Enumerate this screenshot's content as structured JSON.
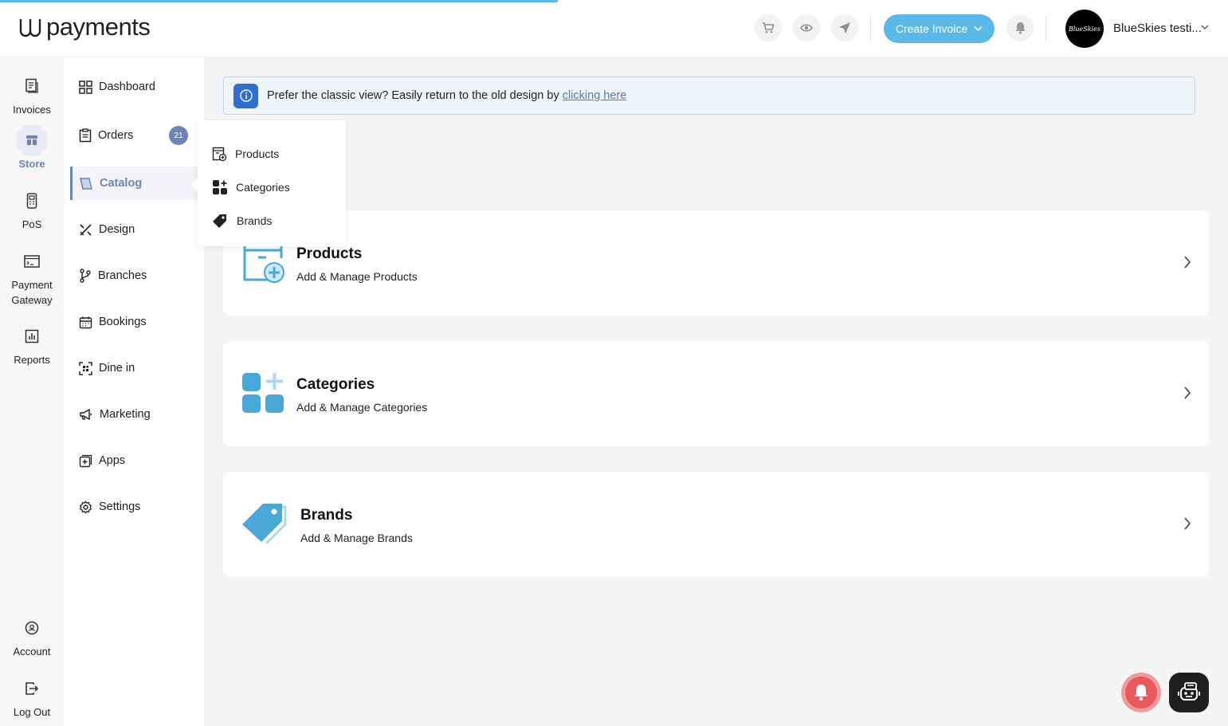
{
  "brand": {
    "logo_text": "payments"
  },
  "header": {
    "create_invoice_label": "Create Invoice",
    "user_name": "BlueSkies testi...",
    "avatar_text": "BlueSkies"
  },
  "rail": {
    "invoices": "Invoices",
    "store": "Store",
    "pos": "PoS",
    "payment_gateway": "Payment Gateway",
    "reports": "Reports",
    "account": "Account",
    "logout": "Log Out"
  },
  "sidebar": {
    "dashboard": "Dashboard",
    "orders": "Orders",
    "orders_badge": "21",
    "catalog": "Catalog",
    "design": "Design",
    "branches": "Branches",
    "bookings": "Bookings",
    "dine_in": "Dine in",
    "marketing": "Marketing",
    "apps": "Apps",
    "settings": "Settings"
  },
  "flyout": {
    "products": "Products",
    "categories": "Categories",
    "brands": "Brands"
  },
  "banner": {
    "text": "Prefer the classic view? Easily return to the old design by",
    "link": "clicking here"
  },
  "cards": {
    "products_title": "Products",
    "products_sub": "Add & Manage Products",
    "categories_title": "Categories",
    "categories_sub": "Add & Manage Categories",
    "brands_title": "Brands",
    "brands_sub": "Add & Manage Brands"
  },
  "colors": {
    "accent": "#5ab9e6",
    "nav_active": "#6a84b5",
    "card_icon": "#4aa8d8"
  }
}
